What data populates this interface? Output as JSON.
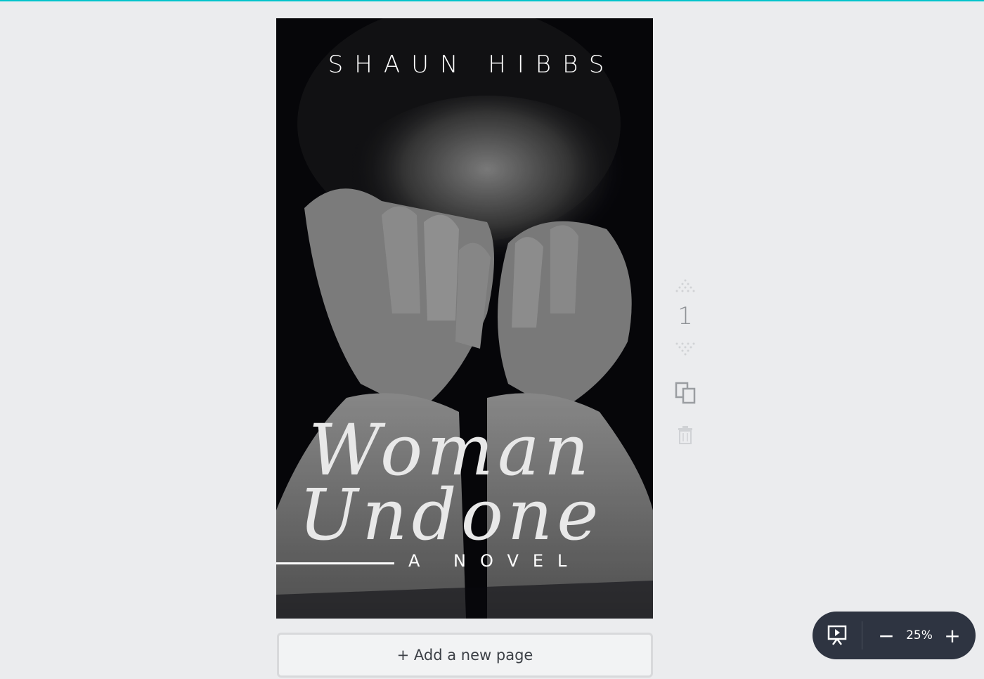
{
  "colors": {
    "accent": "#00c4cc",
    "background": "#ebecee",
    "zoom_bar": "#2e3441"
  },
  "cover": {
    "author": "SHAUN HIBBS",
    "title_line_1": "Woman",
    "title_line_2": "Undone",
    "subtitle": "A NOVEL",
    "image": "woman-covering-face-photo"
  },
  "page_controls": {
    "page_number": "1",
    "move_up_icon": "chevron-up-icon",
    "move_down_icon": "chevron-down-icon",
    "duplicate_icon": "duplicate-icon",
    "delete_icon": "trash-icon"
  },
  "add_page": {
    "label": "+ Add a new page"
  },
  "zoom": {
    "present_icon": "present-icon",
    "minus_label": "−",
    "value": "25%",
    "plus_label": "+"
  }
}
